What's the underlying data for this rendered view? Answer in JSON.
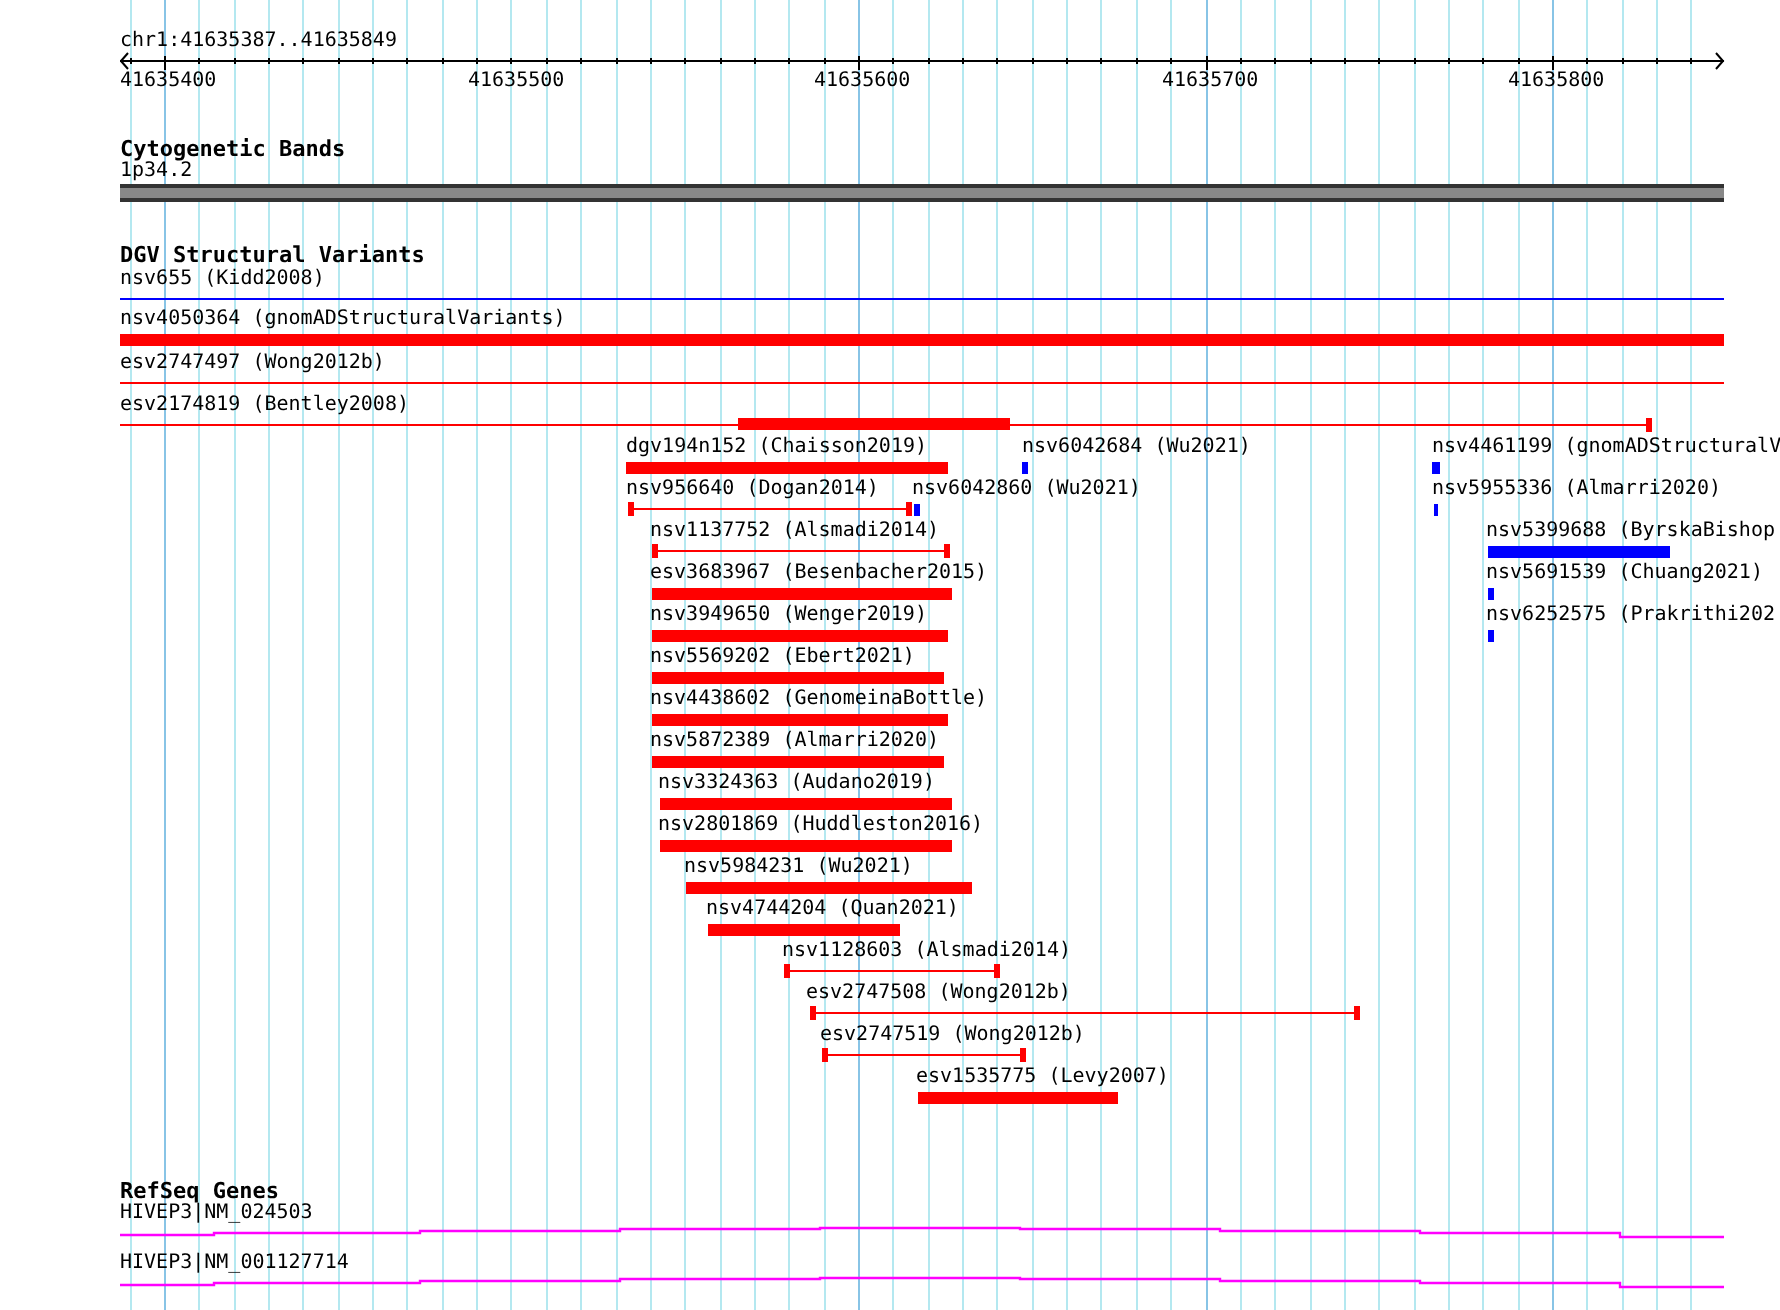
{
  "location": "chr1:41635387..41635849",
  "ruler": {
    "ticks": [
      "41635400",
      "41635500",
      "41635600",
      "41635700",
      "41635800"
    ]
  },
  "tracks": [
    {
      "kind": "bands",
      "title": "Cytogenetic Bands",
      "features": [
        {
          "label": "1p34.2",
          "kind": "band"
        }
      ]
    },
    {
      "kind": "variants",
      "title": "DGV Structural Variants",
      "features": [
        {
          "label": "nsv655 (Kidd2008)",
          "kind": "line",
          "color": "#0000ff"
        },
        {
          "label": "nsv4050364 (gnomADStructuralVariants)",
          "kind": "block",
          "color": "#ff0000"
        },
        {
          "label": "esv2747497 (Wong2012b)",
          "kind": "line",
          "color": "#ff0000"
        },
        {
          "label": "esv2174819 (Bentley2008)",
          "kind": "mixed",
          "color": "#ff0000"
        },
        {
          "label": "dgv194n152 (Chaisson2019)",
          "kind": "block",
          "color": "#ff0000"
        },
        {
          "label": "nsv6042684 (Wu2021)",
          "kind": "block",
          "color": "#0000ff"
        },
        {
          "label": "nsv4461199 (gnomADStructuralV",
          "kind": "block",
          "color": "#0000ff"
        },
        {
          "label": "nsv956640 (Dogan2014)",
          "kind": "interval",
          "color": "#ff0000"
        },
        {
          "label": "nsv6042860 (Wu2021)",
          "kind": "block",
          "color": "#0000ff"
        },
        {
          "label": "nsv5955336 (Almarri2020)",
          "kind": "block",
          "color": "#0000ff"
        },
        {
          "label": "nsv1137752 (Alsmadi2014)",
          "kind": "interval",
          "color": "#ff0000"
        },
        {
          "label": "nsv5399688 (ByrskaBishop",
          "kind": "block",
          "color": "#0000ff"
        },
        {
          "label": "esv3683967 (Besenbacher2015)",
          "kind": "block",
          "color": "#ff0000"
        },
        {
          "label": "nsv5691539 (Chuang2021)",
          "kind": "block",
          "color": "#0000ff"
        },
        {
          "label": "nsv3949650 (Wenger2019)",
          "kind": "block",
          "color": "#ff0000"
        },
        {
          "label": "nsv6252575 (Prakrithi202",
          "kind": "block",
          "color": "#0000ff"
        },
        {
          "label": "nsv5569202 (Ebert2021)",
          "kind": "block",
          "color": "#ff0000"
        },
        {
          "label": "nsv4438602 (GenomeinaBottle)",
          "kind": "block",
          "color": "#ff0000"
        },
        {
          "label": "nsv5872389 (Almarri2020)",
          "kind": "block",
          "color": "#ff0000"
        },
        {
          "label": "nsv3324363 (Audano2019)",
          "kind": "block",
          "color": "#ff0000"
        },
        {
          "label": "nsv2801869 (Huddleston2016)",
          "kind": "block",
          "color": "#ff0000"
        },
        {
          "label": "nsv5984231 (Wu2021)",
          "kind": "block",
          "color": "#ff0000"
        },
        {
          "label": "nsv4744204 (Quan2021)",
          "kind": "block",
          "color": "#ff0000"
        },
        {
          "label": "nsv1128603 (Alsmadi2014)",
          "kind": "interval",
          "color": "#ff0000"
        },
        {
          "label": "esv2747508 (Wong2012b)",
          "kind": "interval",
          "color": "#ff0000"
        },
        {
          "label": "esv2747519 (Wong2012b)",
          "kind": "interval",
          "color": "#ff0000"
        },
        {
          "label": "esv1535775 (Levy2007)",
          "kind": "block",
          "color": "#ff0000"
        }
      ]
    },
    {
      "kind": "genes",
      "title": "RefSeq Genes",
      "features": [
        {
          "label": "HIVEP3|NM_024503",
          "kind": "transcript"
        },
        {
          "label": "HIVEP3|NM_001127714",
          "kind": "transcript"
        }
      ]
    }
  ]
}
